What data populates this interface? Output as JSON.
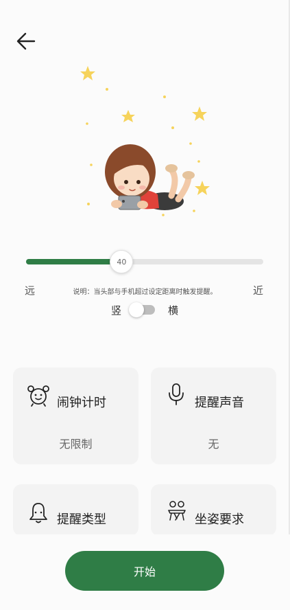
{
  "header": {
    "back_icon": "arrow-left-icon"
  },
  "illustration": {
    "subject": "girl-with-phone-illustration"
  },
  "distance": {
    "value": "40",
    "fraction": 0.4,
    "label_far": "远",
    "label_near": "近",
    "hint": "说明：当头部与手机超过设定距离时触发提醒。"
  },
  "orientation": {
    "portrait_label": "竖",
    "landscape_label": "横",
    "enabled": false
  },
  "cards": {
    "alarm": {
      "title": "闹钟计时",
      "value": "无限制",
      "icon": "alarm-clock-icon"
    },
    "sound": {
      "title": "提醒声音",
      "value": "无",
      "icon": "microphone-icon"
    },
    "type": {
      "title": "提醒类型",
      "icon": "bell-icon"
    },
    "posture": {
      "title": "坐姿要求",
      "icon": "desk-posture-icon"
    }
  },
  "start_button": {
    "label": "开始"
  },
  "colors": {
    "accent": "#2f7d46",
    "card_bg": "#f3f3f3",
    "track": "#e4e4e4",
    "star": "#f6d35b"
  }
}
